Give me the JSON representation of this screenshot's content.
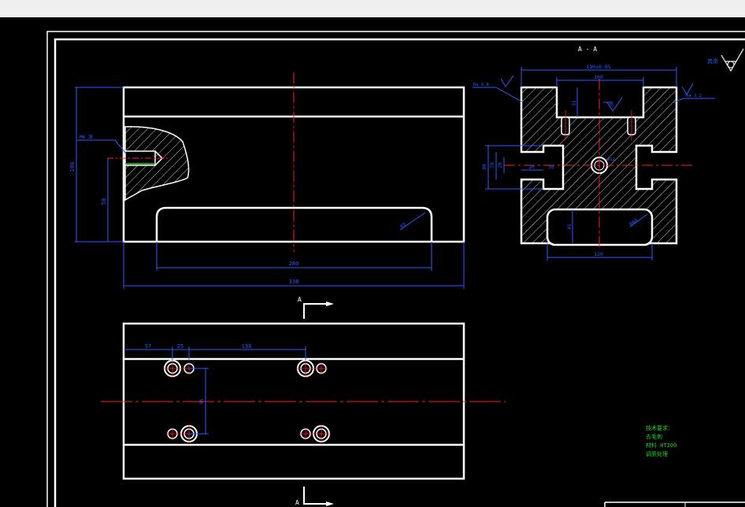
{
  "section_title": "A - A",
  "dims": {
    "w_190": "190±0.05",
    "w_160": "160",
    "h_35a": "35",
    "h_35b": "35",
    "h_90": "90",
    "h_70": "70",
    "h_20": "20",
    "w_20": "20",
    "w_50": "50",
    "d_12": "Ø12",
    "r_60": "R60",
    "w_120": "120",
    "h_45": "45",
    "ra": "Ra 0.8",
    "front_h100": "100",
    "front_h50": "50",
    "front_r5": "R5",
    "front_w280": "280",
    "front_w338": "338",
    "plan_57": "57",
    "plan_25": "25",
    "plan_138": "138",
    "plan_v": "95"
  },
  "leaders": {
    "left_top": "Ra 0.8",
    "left_front": "M6 深",
    "right": "Ra 3.2"
  },
  "section_marker": "A",
  "roughness_note": "其余",
  "notes": {
    "line1": "技术要求：",
    "line2": "去毛刺",
    "line3": "材料 HT200",
    "line4": "调质处理"
  },
  "colors": {
    "outline": "#ffffff",
    "dimension": "#2d5bff",
    "center": "#ff2020",
    "hatch": "#ffffff",
    "note": "#26d326"
  }
}
